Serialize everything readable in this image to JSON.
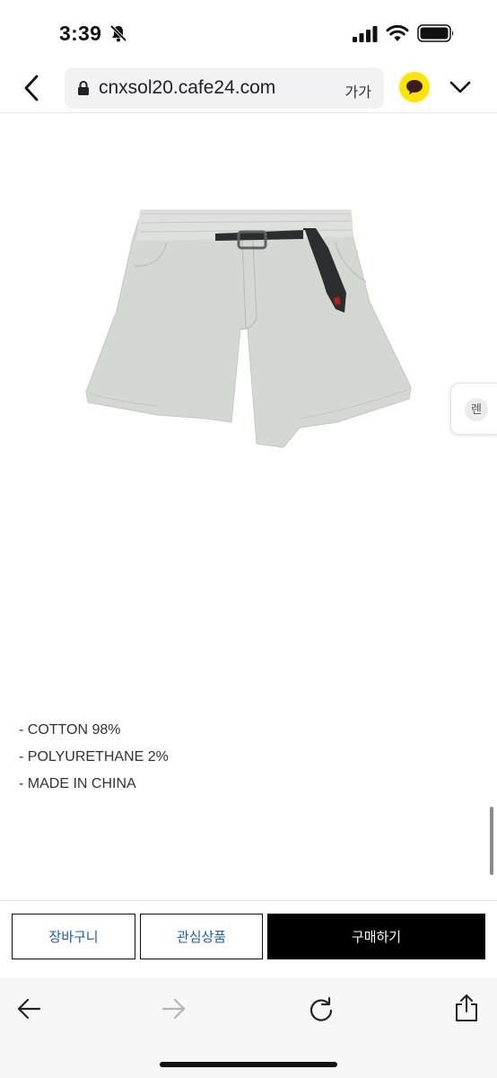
{
  "status_bar": {
    "time": "3:39",
    "icons": [
      "bell-slash-icon",
      "cellular-signal-icon",
      "wifi-icon",
      "battery-icon"
    ]
  },
  "browser": {
    "url": "cnxsol20.cafe24.com",
    "text_size_label": "가가",
    "icons": [
      "back-chevron-icon",
      "lock-icon",
      "kakao-talk-icon",
      "chevron-down-icon"
    ]
  },
  "product": {
    "image_icon": "shorts-product-image",
    "side_tab_label": "렌",
    "specs": [
      "- COTTON 98%",
      "- POLYURETHANE 2%",
      "- MADE IN CHINA"
    ]
  },
  "actions": {
    "cart_label": "장바구니",
    "wish_label": "관심상품",
    "buy_label": "구매하기"
  },
  "toolbar": {
    "icons": [
      "arrow-back-icon",
      "arrow-forward-icon",
      "reload-icon",
      "share-icon"
    ]
  },
  "colors": {
    "accent_text": "#1a5fb4",
    "buy_background": "#000000",
    "kakao_yellow": "#fee500",
    "shorts_fabric": "#d4d8d2"
  }
}
